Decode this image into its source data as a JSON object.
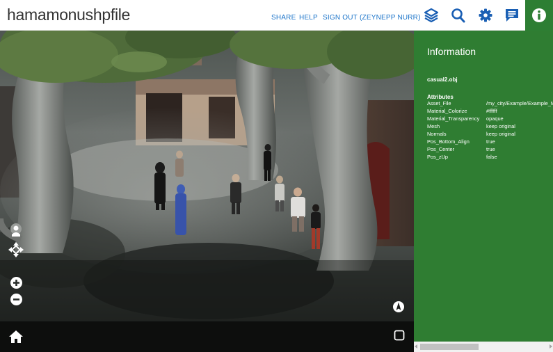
{
  "header": {
    "title": "hamamonushpfile",
    "links": [
      "SHARE",
      "HELP",
      "SIGN OUT",
      "(ZEYNEPP NURR)"
    ]
  },
  "toolbar": {
    "icons": [
      "layers-icon",
      "search-icon",
      "gear-icon",
      "comment-icon",
      "info-icon"
    ],
    "active": "info-icon"
  },
  "scene_controls": {
    "icons": [
      "navigate-icon",
      "move-icon",
      "zoom-in-icon",
      "zoom-out-icon",
      "compass-icon",
      "home-icon",
      "fullscreen-icon"
    ]
  },
  "info_panel": {
    "heading": "Information",
    "asset_name": "casual2.obj",
    "attributes_heading": "Attributes",
    "attributes": [
      {
        "key": "Asset_File",
        "value": "/my_city/Example/Example_M"
      },
      {
        "key": "Material_Colorize",
        "value": "#ffffff"
      },
      {
        "key": "Material_Transparency",
        "value": "opaque"
      },
      {
        "key": "Mesh",
        "value": "keep original"
      },
      {
        "key": "Normals",
        "value": "keep original"
      },
      {
        "key": "Pos_Bottom_Align",
        "value": "true"
      },
      {
        "key": "Pos_Center",
        "value": "true"
      },
      {
        "key": "Pos_zUp",
        "value": "false"
      }
    ]
  },
  "colors": {
    "accent_green": "#2f7d32",
    "link_blue": "#1a73c9",
    "toolbar_icon": "#1a5fb4"
  }
}
